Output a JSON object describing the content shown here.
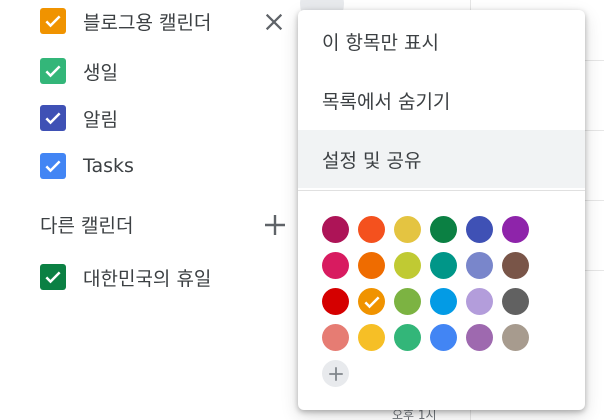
{
  "calendar_list": {
    "my_calendars": [
      {
        "label": "블로그용 캘린더",
        "color": "#f09300",
        "checked": true
      },
      {
        "label": "생일",
        "color": "#33b679",
        "checked": true
      },
      {
        "label": "알림",
        "color": "#3f51b5",
        "checked": true
      },
      {
        "label": "Tasks",
        "color": "#4285f4",
        "checked": true
      }
    ],
    "other_section_title": "다른 캘린더",
    "other_calendars": [
      {
        "label": "대한민국의 휴일",
        "color": "#0b8043",
        "checked": true
      }
    ]
  },
  "menu": {
    "items": [
      {
        "label": "이 항목만 표시"
      },
      {
        "label": "목록에서 숨기기"
      },
      {
        "label": "설정 및 공유",
        "hovered": true
      }
    ],
    "color_palette": [
      [
        "#ad1457",
        "#f4511e",
        "#e4c441",
        "#0b8043",
        "#3f51b5",
        "#8e24aa"
      ],
      [
        "#d81b60",
        "#ef6c00",
        "#c0ca33",
        "#009688",
        "#7986cb",
        "#795548"
      ],
      [
        "#d50000",
        "#f09300",
        "#7cb342",
        "#039be5",
        "#b39ddb",
        "#616161"
      ],
      [
        "#e67c73",
        "#f6bf26",
        "#33b679",
        "#4285f4",
        "#9e69af",
        "#a79b8e"
      ]
    ],
    "selected_color": "#f09300"
  },
  "background": {
    "partial_label": "오후 1시"
  }
}
